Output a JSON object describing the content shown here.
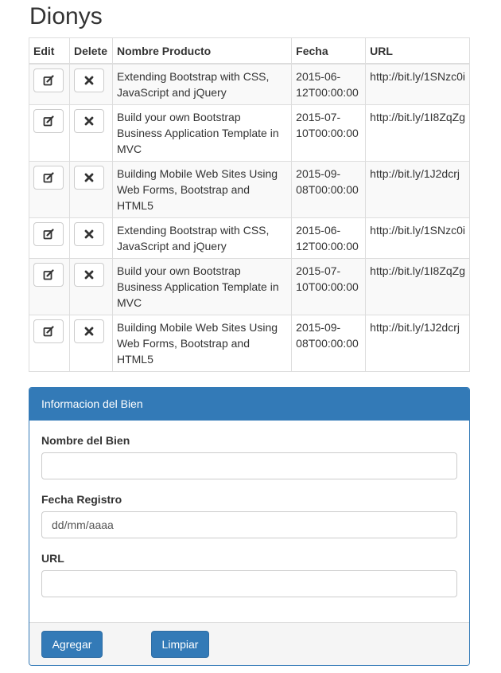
{
  "page": {
    "title": "Dionys"
  },
  "table": {
    "headers": {
      "edit": "Edit",
      "delete": "Delete",
      "name": "Nombre Producto",
      "date": "Fecha",
      "url": "URL"
    },
    "rows": [
      {
        "name": "Extending Bootstrap with CSS, JavaScript and jQuery",
        "date": "2015-06-12T00:00:00",
        "url": "http://bit.ly/1SNzc0i"
      },
      {
        "name": "Build your own Bootstrap Business Application Template in MVC",
        "date": "2015-07-10T00:00:00",
        "url": "http://bit.ly/1I8ZqZg"
      },
      {
        "name": "Building Mobile Web Sites Using Web Forms, Bootstrap and HTML5",
        "date": "2015-09-08T00:00:00",
        "url": "http://bit.ly/1J2dcrj"
      },
      {
        "name": "Extending Bootstrap with CSS, JavaScript and jQuery",
        "date": "2015-06-12T00:00:00",
        "url": "http://bit.ly/1SNzc0i"
      },
      {
        "name": "Build your own Bootstrap Business Application Template in MVC",
        "date": "2015-07-10T00:00:00",
        "url": "http://bit.ly/1I8ZqZg"
      },
      {
        "name": "Building Mobile Web Sites Using Web Forms, Bootstrap and HTML5",
        "date": "2015-09-08T00:00:00",
        "url": "http://bit.ly/1J2dcrj"
      }
    ],
    "edit_icon": "edit-icon",
    "delete_icon": "remove-icon"
  },
  "form": {
    "heading": "Informacion del Bien",
    "name_label": "Nombre del Bien",
    "name_value": "",
    "date_label": "Fecha Registro",
    "date_placeholder": "dd/mm/aaaa",
    "url_label": "URL",
    "url_value": "",
    "add_label": "Agregar",
    "clear_label": "Limpiar"
  },
  "colors": {
    "primary": "#337ab7",
    "border": "#dddddd",
    "stripe": "#f9f9f9",
    "footer": "#f5f5f5"
  }
}
